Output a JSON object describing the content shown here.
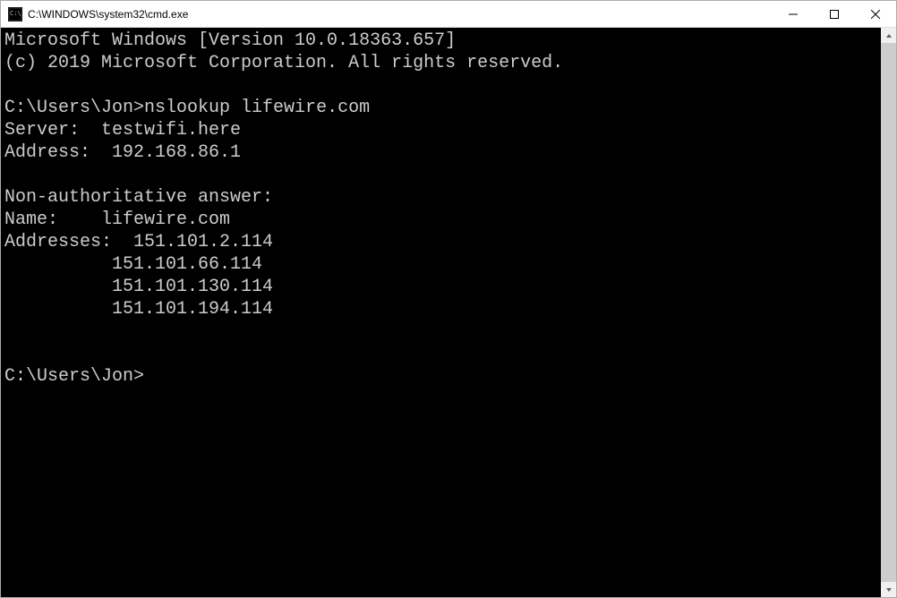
{
  "window": {
    "title": "C:\\WINDOWS\\system32\\cmd.exe"
  },
  "terminal": {
    "banner_line1": "Microsoft Windows [Version 10.0.18363.657]",
    "banner_line2": "(c) 2019 Microsoft Corporation. All rights reserved.",
    "prompt1_path": "C:\\Users\\Jon>",
    "command1": "nslookup lifewire.com",
    "server_label": "Server:  ",
    "server_value": "testwifi.here",
    "address_label": "Address:  ",
    "address_value": "192.168.86.1",
    "nonauth_label": "Non-authoritative answer:",
    "name_label": "Name:    ",
    "name_value": "lifewire.com",
    "addresses_label": "Addresses:  ",
    "addr1": "151.101.2.114",
    "addr_indent": "          ",
    "addr2": "151.101.66.114",
    "addr3": "151.101.130.114",
    "addr4": "151.101.194.114",
    "prompt2_path": "C:\\Users\\Jon>"
  }
}
